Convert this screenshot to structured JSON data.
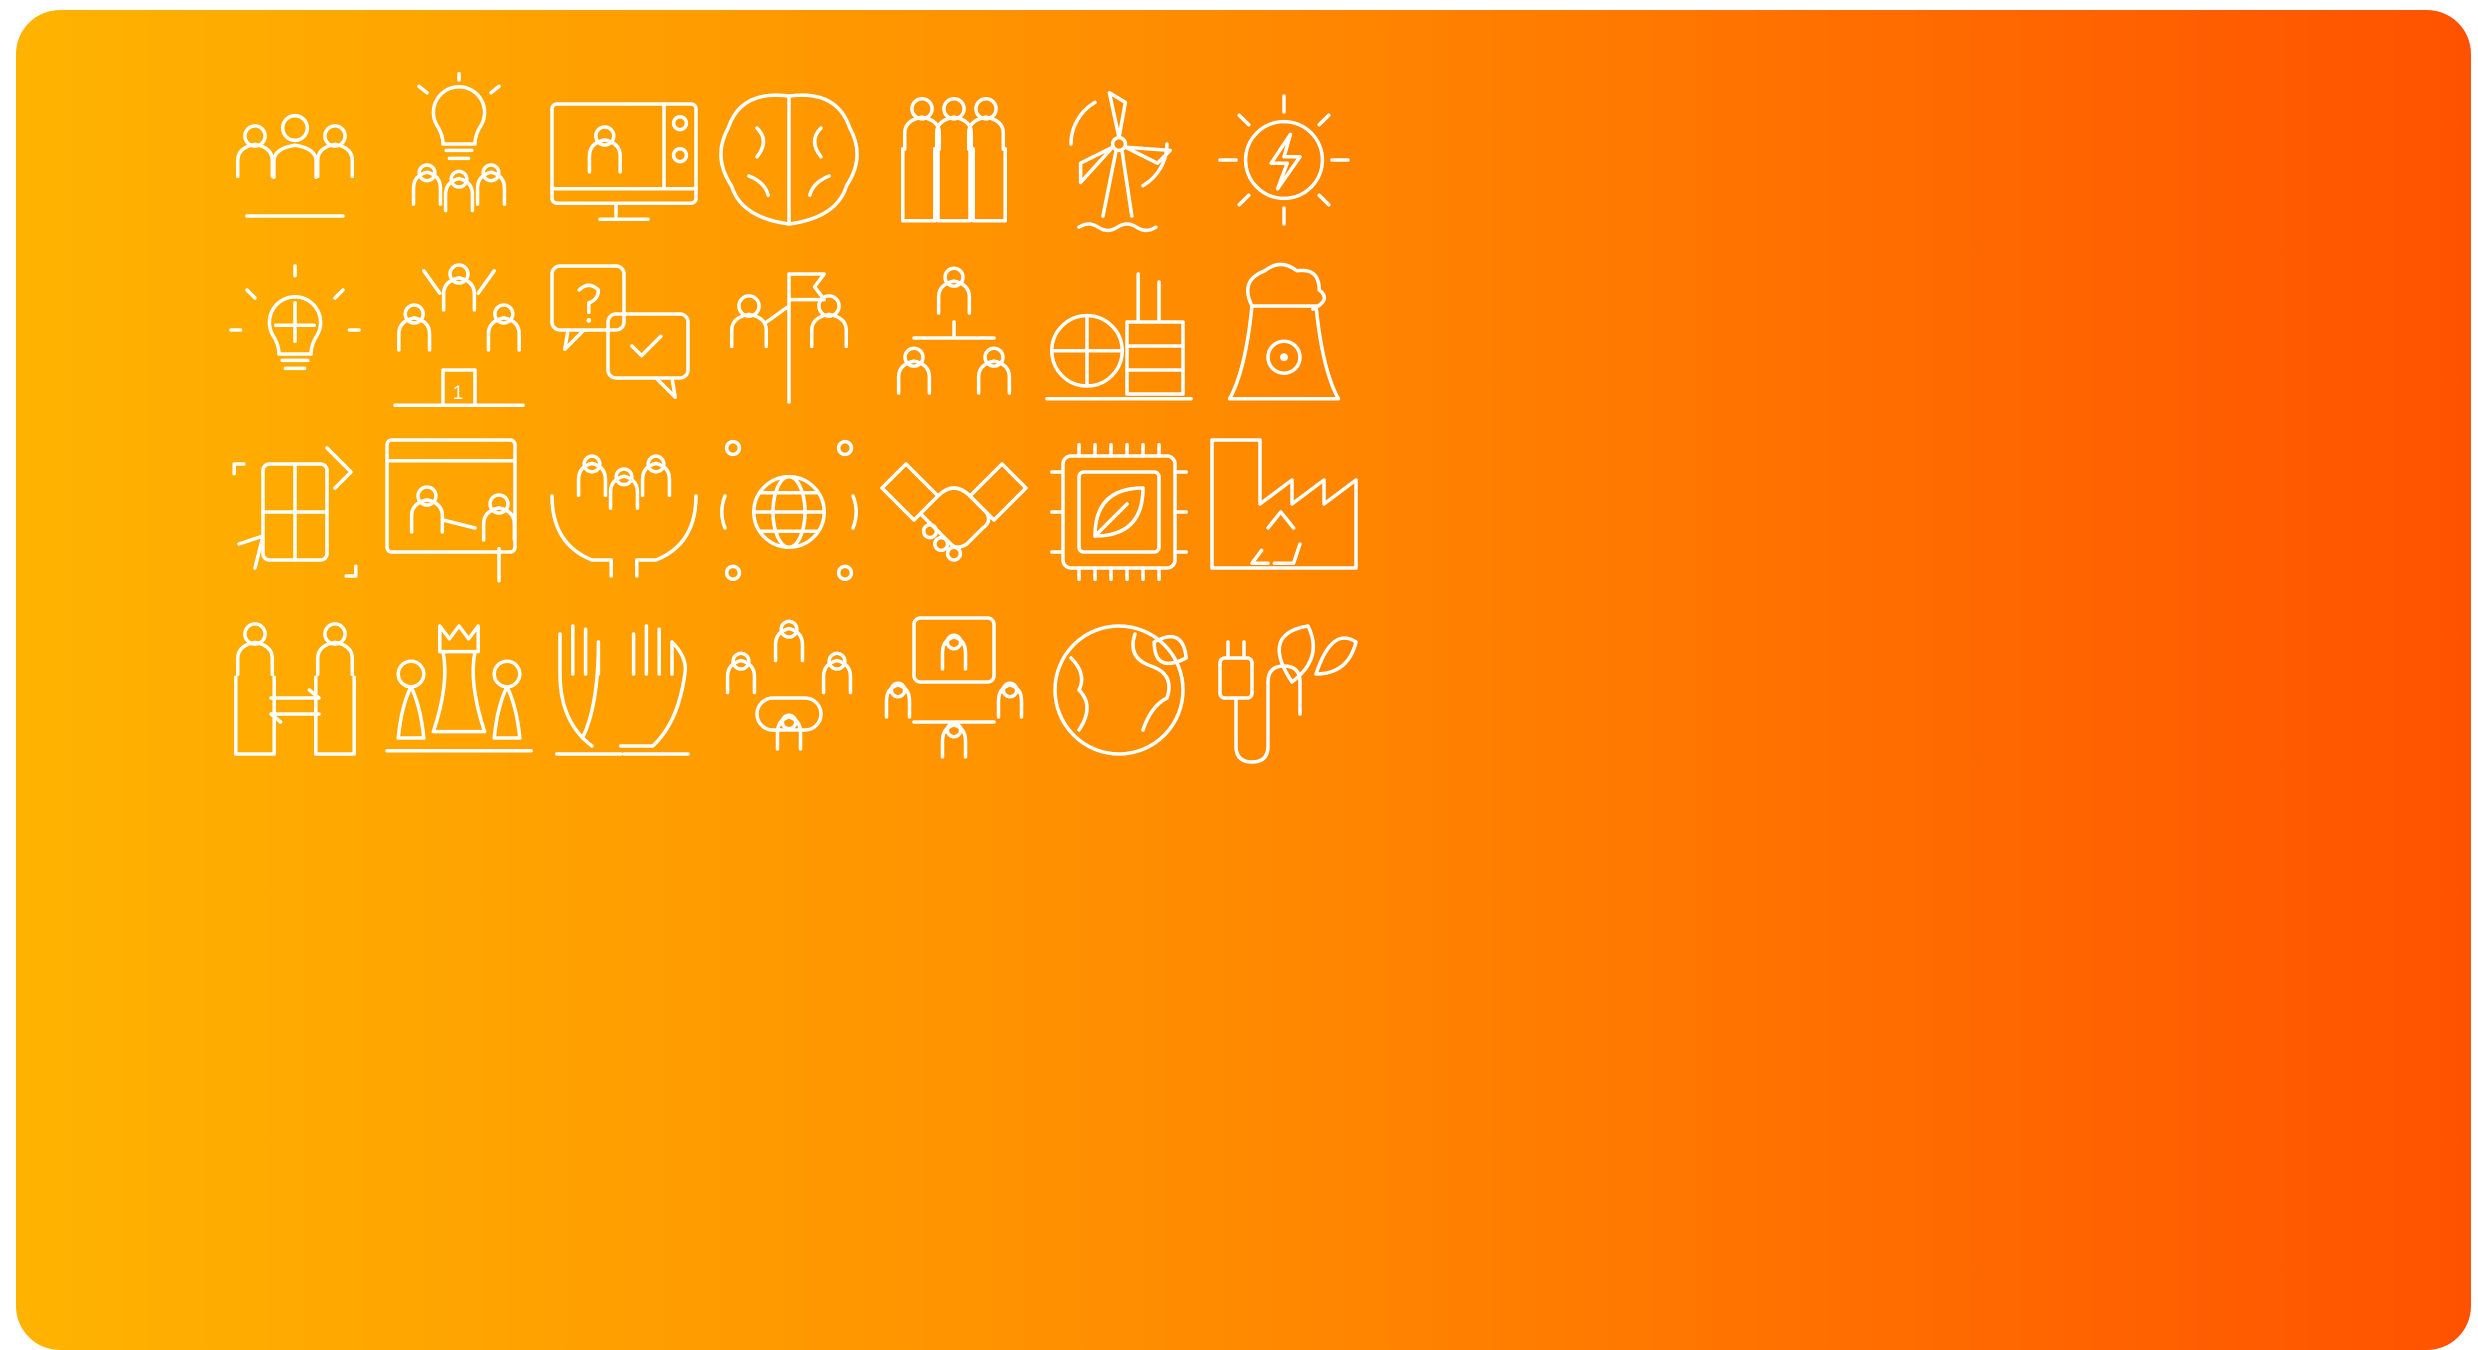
{
  "palette": {
    "gradient_start": "#FFB300",
    "gradient_mid": "#FF8A00",
    "gradient_end": "#FF5200",
    "icon_stroke": "#FFFFFF",
    "page_background": "#FFFFFF"
  },
  "icons": [
    [
      "team-icon",
      "idea-team-icon",
      "video-conference-icon",
      "brain-icon",
      "group-icon",
      "wind-turbine-icon",
      "solar-energy-icon"
    ],
    [
      "puzzle-bulb-icon",
      "winners-podium-icon",
      "question-answer-chat-icon",
      "leader-flag-icon",
      "hierarchy-icon",
      "power-plant-icon",
      "nuclear-plant-icon"
    ],
    [
      "puzzle-hands-icon",
      "presentation-icon",
      "care-community-icon",
      "global-network-icon",
      "handshake-icon",
      "eco-chip-icon",
      "recycling-factory-icon"
    ],
    [
      "exchange-people-icon",
      "chess-strategy-icon",
      "raised-hands-icon",
      "meeting-table-icon",
      "video-meeting-icon",
      "earth-leaf-icon",
      "eco-plug-icon"
    ]
  ]
}
